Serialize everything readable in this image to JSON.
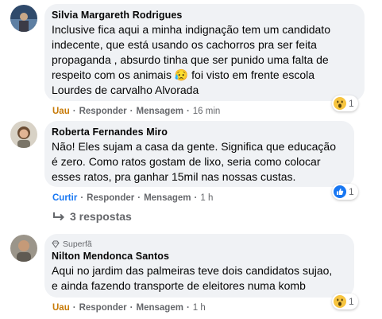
{
  "comments": [
    {
      "author": "Silvia Margareth Rodrigues",
      "lines": [
        "Inclusive fica aqui a minha indignação tem um candidato",
        "indecente, que está usando os cachorros pra ser feita",
        "propaganda , absurdo tinha que ser punido uma falta de",
        "respeito com os animais 😥 foi visto em frente escola",
        "Lourdes de carvalho Alvorada"
      ],
      "reaction_label": "Uau",
      "reply_label": "Responder",
      "message_label": "Mensagem",
      "time": "16 min",
      "reaction_icon": "wow-emoji-icon",
      "reaction_count": "1"
    },
    {
      "author": "Roberta Fernandes Miro",
      "lines": [
        "Não! Eles sujam a casa da gente. Significa que educação",
        "é zero. Como ratos gostam de lixo, seria como colocar",
        "esses ratos, pra ganhar 15mil nas nossas custas."
      ],
      "reaction_label": "Curtir",
      "reply_label": "Responder",
      "message_label": "Mensagem",
      "time": "1 h",
      "reaction_icon": "like-thumb-icon",
      "reaction_count": "1",
      "replies_label": "3 respostas"
    },
    {
      "badge": "Superfã",
      "author": "Nilton Mendonca Santos",
      "lines": [
        "Aqui no jardim das palmeiras teve dois candidatos sujao,",
        "e ainda fazendo transporte de eleitores numa komb"
      ],
      "reaction_label": "Uau",
      "reply_label": "Responder",
      "message_label": "Mensagem",
      "time": "1 h",
      "reaction_icon": "wow-emoji-icon",
      "reaction_count": "1"
    }
  ],
  "colors": {
    "bubble": "#f0f2f5",
    "muted_text": "#65676b",
    "wow": "#c77a07",
    "like": "#1877f2"
  }
}
